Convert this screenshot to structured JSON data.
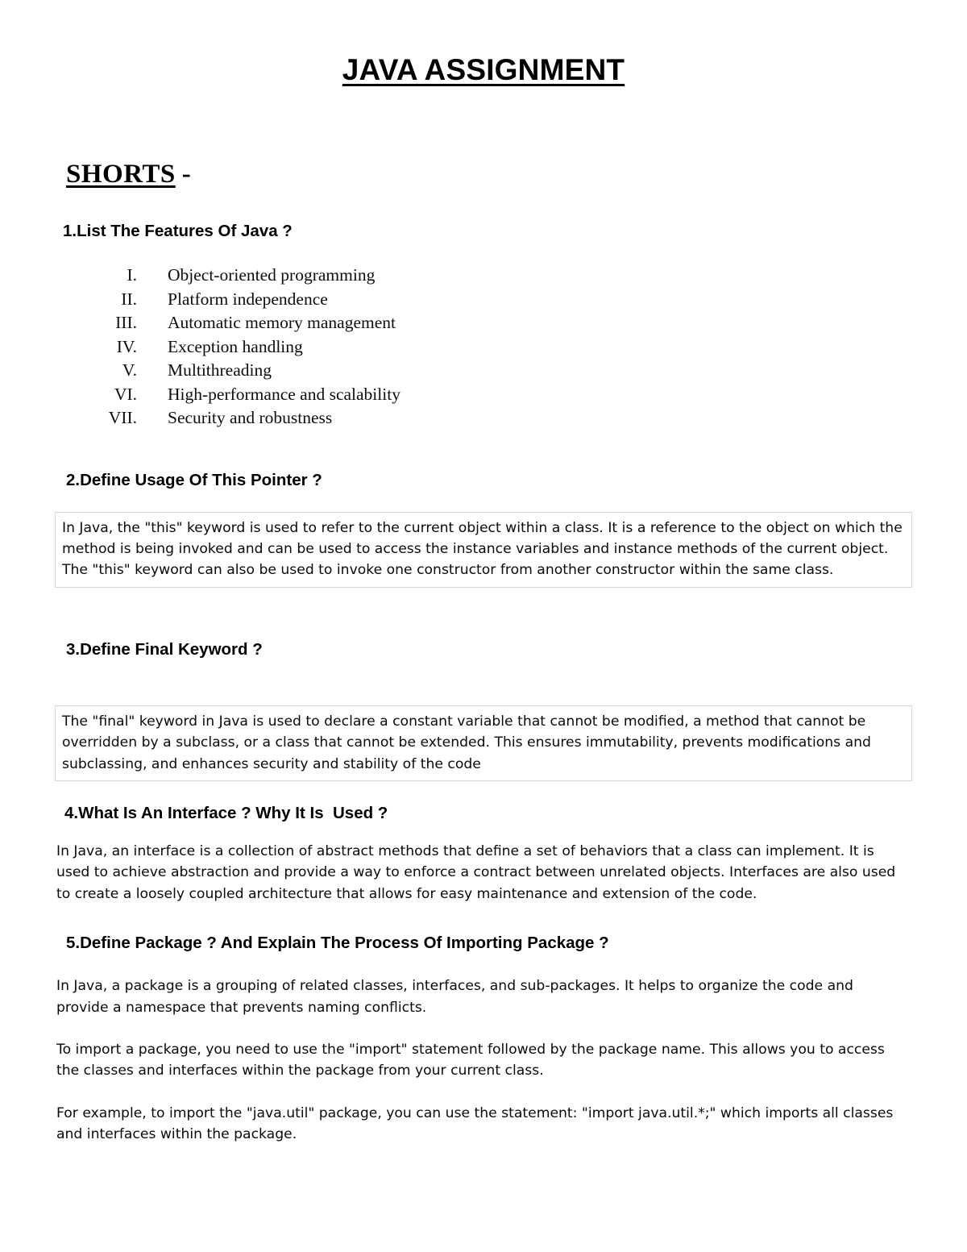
{
  "document": {
    "title": "JAVA ASSIGNMENT",
    "section_heading": "SHORTS",
    "section_heading_dash": "-"
  },
  "questions": [
    {
      "heading": "1.List The Features Of Java ?",
      "list": [
        {
          "numeral": "I.",
          "text": "Object-oriented programming"
        },
        {
          "numeral": "II.",
          "text": "Platform independence"
        },
        {
          "numeral": "III.",
          "text": "Automatic memory management"
        },
        {
          "numeral": "IV.",
          "text": "Exception handling"
        },
        {
          "numeral": "V.",
          "text": "Multithreading"
        },
        {
          "numeral": "VI.",
          "text": "High-performance and scalability"
        },
        {
          "numeral": "VII.",
          "text": "Security and robustness"
        }
      ]
    },
    {
      "heading": "2.Define Usage Of This Pointer ?",
      "answer": "In Java, the \"this\" keyword is used to refer to the current object within a class. It is a reference to the object on which the method is being invoked and can be used to access the instance variables and instance methods of the current object. The \"this\" keyword can also be used to invoke one constructor from another constructor within the same class."
    },
    {
      "heading": "3.Define Final Keyword ?",
      "answer": "The \"final\" keyword in Java is used to declare a constant variable that cannot be modified, a method that cannot be overridden by a subclass, or a class that cannot be extended. This ensures immutability, prevents modifications and subclassing, and enhances security and stability of the code"
    },
    {
      "heading": "4.What Is An Interface ? Why It Is  Used ?",
      "answer": "In Java, an interface is a collection of abstract methods that define a set of behaviors that a class can implement. It is used to achieve abstraction and provide a way to enforce a contract between unrelated objects. Interfaces are also used to create a loosely coupled architecture that allows for easy maintenance and extension of the code."
    },
    {
      "heading": "5.Define Package ? And Explain The Process Of Importing Package ?",
      "answer_paragraphs": [
        "In Java, a package is a grouping of related classes, interfaces, and sub-packages. It helps to organize the code and provide a namespace that prevents naming conflicts.",
        "To import a package, you need to use the \"import\" statement followed by the package name. This allows you to access the classes and interfaces within the package from your current class.",
        "For example, to import the \"java.util\" package, you can use the statement: \"import java.util.*;\" which imports all classes and interfaces within the package."
      ]
    }
  ],
  "colors": {
    "page_background": "#ffffff",
    "text": "#000000",
    "box_border": "#d9d9d9"
  }
}
